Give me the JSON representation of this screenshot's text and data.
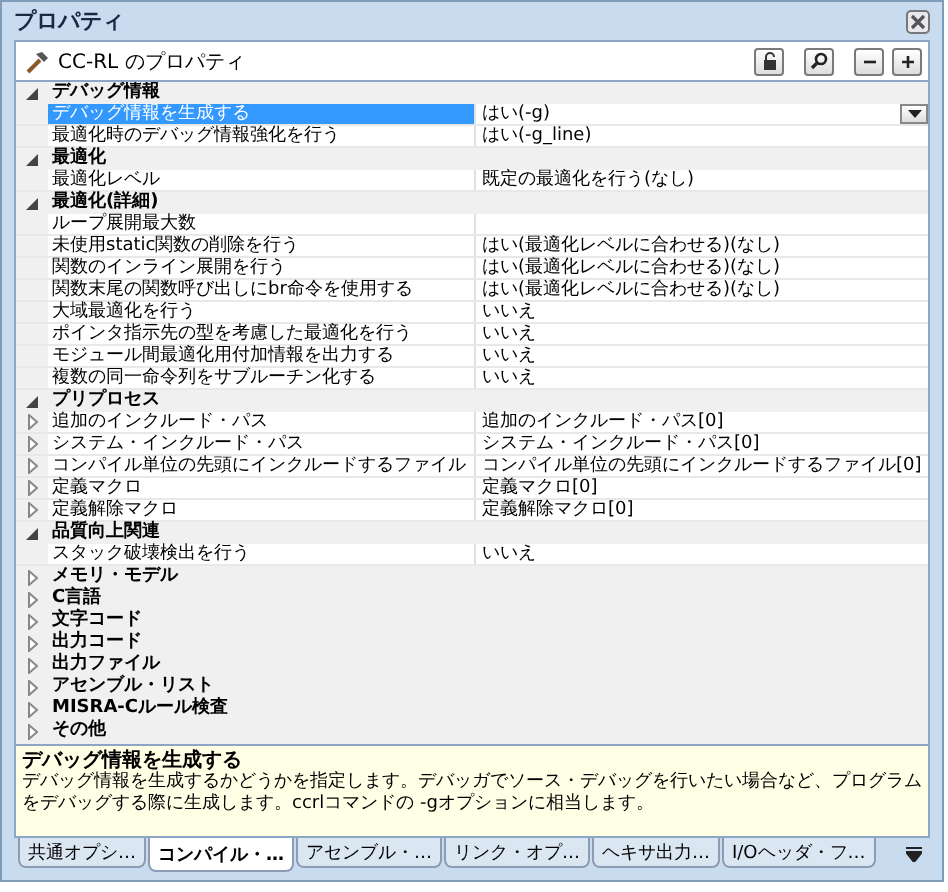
{
  "panel": {
    "title": "プロパティ"
  },
  "toolbar": {
    "title": "CC-RL のプロパティ"
  },
  "categories": [
    {
      "name": "デバッグ情報",
      "expanded": true,
      "items": [
        {
          "name": "デバッグ情報を生成する",
          "value": "はい(-g)",
          "selected": true
        },
        {
          "name": "最適化時のデバッグ情報強化を行う",
          "value": "はい(-g_line)",
          "selected": false
        }
      ]
    },
    {
      "name": "最適化",
      "expanded": true,
      "items": [
        {
          "name": "最適化レベル",
          "value": "既定の最適化を行う(なし)",
          "selected": false
        }
      ]
    },
    {
      "name": "最適化(詳細)",
      "expanded": true,
      "items": [
        {
          "name": "ループ展開最大数",
          "selected": false
        },
        {
          "name": "未使用static関数の削除を行う",
          "value": "はい(最適化レベルに合わせる)(なし)",
          "selected": false
        },
        {
          "name": "関数のインライン展開を行う",
          "value": "はい(最適化レベルに合わせる)(なし)",
          "selected": false
        },
        {
          "name": "関数末尾の関数呼び出しにbr命令を使用する",
          "value": "はい(最適化レベルに合わせる)(なし)",
          "selected": false
        },
        {
          "name": "大域最適化を行う",
          "value": "いいえ",
          "selected": false
        },
        {
          "name": "ポインタ指示先の型を考慮した最適化を行う",
          "value": "いいえ",
          "selected": false
        },
        {
          "name": "モジュール間最適化用付加情報を出力する",
          "value": "いいえ",
          "selected": false
        },
        {
          "name": "複数の同一命令列をサブルーチン化する",
          "value": "いいえ",
          "selected": false
        }
      ]
    },
    {
      "name": "プリプロセス",
      "expanded": true,
      "items": [
        {
          "name": "追加のインクルード・パス",
          "value": "追加のインクルード・パス[0]",
          "selected": false,
          "expanded": false
        },
        {
          "name": "システム・インクルード・パス",
          "value": "システム・インクルード・パス[0]",
          "selected": false,
          "expanded": false
        },
        {
          "name": "コンパイル単位の先頭にインクルードするファイル",
          "value": "コンパイル単位の先頭にインクルードするファイル[0]",
          "selected": false,
          "expanded": false
        },
        {
          "name": "定義マクロ",
          "value": "定義マクロ[0]",
          "selected": false,
          "expanded": false
        },
        {
          "name": "定義解除マクロ",
          "value": "定義解除マクロ[0]",
          "selected": false,
          "expanded": false
        }
      ]
    },
    {
      "name": "品質向上関連",
      "expanded": true,
      "items": [
        {
          "name": "スタック破壊検出を行う",
          "value": "いいえ",
          "selected": false
        }
      ]
    },
    {
      "name": "メモリ・モデル",
      "expanded": false
    },
    {
      "name": "C言語",
      "expanded": false
    },
    {
      "name": "文字コード",
      "expanded": false
    },
    {
      "name": "出力コード",
      "expanded": false
    },
    {
      "name": "出力ファイル",
      "expanded": false
    },
    {
      "name": "アセンブル・リスト",
      "expanded": false
    },
    {
      "name": "MISRA-Cルール検査",
      "expanded": false
    },
    {
      "name": "その他",
      "expanded": false
    }
  ],
  "description": {
    "title": "デバッグ情報を生成する",
    "text": "デバッグ情報を生成するかどうかを指定します。デバッガでソース・デバッグを行いたい場合など、プログラムをデバッグする際に生成します。ccrlコマンドの -gオプションに相当します。"
  },
  "tabs": [
    {
      "label": "共通オプシ…",
      "selected": false
    },
    {
      "label": "コンパイル・…",
      "selected": true
    },
    {
      "label": "アセンブル・…",
      "selected": false
    },
    {
      "label": "リンク・オプ…",
      "selected": false
    },
    {
      "label": "ヘキサ出力…",
      "selected": false
    },
    {
      "label": "I/Oヘッダ・フ…",
      "selected": false
    }
  ]
}
